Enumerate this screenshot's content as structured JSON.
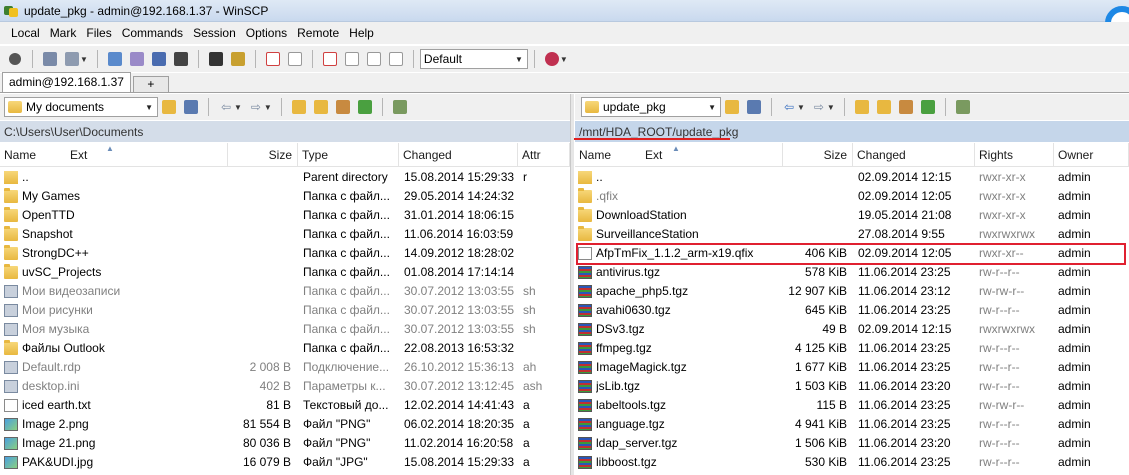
{
  "window": {
    "title": "update_pkg - admin@192.168.1.37 - WinSCP"
  },
  "menu": [
    "Local",
    "Mark",
    "Files",
    "Commands",
    "Session",
    "Options",
    "Remote",
    "Help"
  ],
  "toolbar": {
    "transfer_profile": "Default"
  },
  "tabs": {
    "session": "admin@192.168.1.37",
    "new_tab": "+"
  },
  "local": {
    "location": "My documents",
    "path": "C:\\Users\\User\\Documents",
    "columns": {
      "name": "Name",
      "ext": "Ext",
      "size": "Size",
      "type": "Type",
      "changed": "Changed",
      "attr": "Attr"
    },
    "rows": [
      {
        "name": "..",
        "size": "",
        "type": "Parent directory",
        "changed": "15.08.2014 15:29:33",
        "attr": "r",
        "icon": "up",
        "muted": false
      },
      {
        "name": "My Games",
        "size": "",
        "type": "Папка с файл...",
        "changed": "29.05.2014 14:24:32",
        "attr": "",
        "icon": "folder",
        "muted": false
      },
      {
        "name": "OpenTTD",
        "size": "",
        "type": "Папка с файл...",
        "changed": "31.01.2014 18:06:15",
        "attr": "",
        "icon": "folder",
        "muted": false
      },
      {
        "name": "Snapshot",
        "size": "",
        "type": "Папка с файл...",
        "changed": "11.06.2014 16:03:59",
        "attr": "",
        "icon": "folder",
        "muted": false
      },
      {
        "name": "StrongDC++",
        "size": "",
        "type": "Папка с файл...",
        "changed": "14.09.2012 18:28:02",
        "attr": "",
        "icon": "folder",
        "muted": false
      },
      {
        "name": "uvSC_Projects",
        "size": "",
        "type": "Папка с файл...",
        "changed": "01.08.2014 17:14:14",
        "attr": "",
        "icon": "folder",
        "muted": false
      },
      {
        "name": "Мои видеозаписи",
        "size": "",
        "type": "Папка с файл...",
        "changed": "30.07.2012 13:03:55",
        "attr": "sh",
        "icon": "sysfile",
        "muted": true
      },
      {
        "name": "Мои рисунки",
        "size": "",
        "type": "Папка с файл...",
        "changed": "30.07.2012 13:03:55",
        "attr": "sh",
        "icon": "sysfile",
        "muted": true
      },
      {
        "name": "Моя музыка",
        "size": "",
        "type": "Папка с файл...",
        "changed": "30.07.2012 13:03:55",
        "attr": "sh",
        "icon": "sysfile",
        "muted": true
      },
      {
        "name": "Файлы Outlook",
        "size": "",
        "type": "Папка с файл...",
        "changed": "22.08.2013 16:53:32",
        "attr": "",
        "icon": "folder",
        "muted": false
      },
      {
        "name": "Default.rdp",
        "size": "2 008 B",
        "type": "Подключение...",
        "changed": "26.10.2012 15:36:13",
        "attr": "ah",
        "icon": "sysfile",
        "muted": true
      },
      {
        "name": "desktop.ini",
        "size": "402 B",
        "type": "Параметры к...",
        "changed": "30.07.2012 13:12:45",
        "attr": "ash",
        "icon": "sysfile",
        "muted": true
      },
      {
        "name": "iced earth.txt",
        "size": "81 B",
        "type": "Текстовый до...",
        "changed": "12.02.2014 14:41:43",
        "attr": "a",
        "icon": "doc",
        "muted": false
      },
      {
        "name": "Image 2.png",
        "size": "81 554 B",
        "type": "Файл \"PNG\"",
        "changed": "06.02.2014 18:20:35",
        "attr": "a",
        "icon": "img",
        "muted": false
      },
      {
        "name": "Image 21.png",
        "size": "80 036 B",
        "type": "Файл \"PNG\"",
        "changed": "11.02.2014 16:20:58",
        "attr": "a",
        "icon": "img",
        "muted": false
      },
      {
        "name": "PAK&UDI.jpg",
        "size": "16 079 B",
        "type": "Файл \"JPG\"",
        "changed": "15.08.2014 15:29:33",
        "attr": "a",
        "icon": "img",
        "muted": false
      }
    ]
  },
  "remote": {
    "location": "update_pkg",
    "path": "/mnt/HDA_ROOT/update_pkg",
    "columns": {
      "name": "Name",
      "ext": "Ext",
      "size": "Size",
      "changed": "Changed",
      "rights": "Rights",
      "owner": "Owner"
    },
    "rows": [
      {
        "name": "..",
        "size": "",
        "changed": "02.09.2014 12:15",
        "rights": "rwxr-xr-x",
        "owner": "admin",
        "icon": "up",
        "muted": false
      },
      {
        "name": ".qfix",
        "size": "",
        "changed": "02.09.2014 12:05",
        "rights": "rwxr-xr-x",
        "owner": "admin",
        "icon": "folder",
        "muted": true
      },
      {
        "name": "DownloadStation",
        "size": "",
        "changed": "19.05.2014 21:08",
        "rights": "rwxr-xr-x",
        "owner": "admin",
        "icon": "folder",
        "muted": false
      },
      {
        "name": "SurveillanceStation",
        "size": "",
        "changed": "27.08.2014 9:55",
        "rights": "rwxrwxrwx",
        "owner": "admin",
        "icon": "folder",
        "muted": false
      },
      {
        "name": "AfpTmFix_1.1.2_arm-x19.qfix",
        "size": "406 KiB",
        "changed": "02.09.2014 12:05",
        "rights": "rwxr-xr--",
        "owner": "admin",
        "icon": "doc",
        "muted": false
      },
      {
        "name": "antivirus.tgz",
        "size": "578 KiB",
        "changed": "11.06.2014 23:25",
        "rights": "rw-r--r--",
        "owner": "admin",
        "icon": "arch",
        "muted": false
      },
      {
        "name": "apache_php5.tgz",
        "size": "12 907 KiB",
        "changed": "11.06.2014 23:12",
        "rights": "rw-rw-r--",
        "owner": "admin",
        "icon": "arch",
        "muted": false
      },
      {
        "name": "avahi0630.tgz",
        "size": "645 KiB",
        "changed": "11.06.2014 23:25",
        "rights": "rw-r--r--",
        "owner": "admin",
        "icon": "arch",
        "muted": false
      },
      {
        "name": "DSv3.tgz",
        "size": "49 B",
        "changed": "02.09.2014 12:15",
        "rights": "rwxrwxrwx",
        "owner": "admin",
        "icon": "arch",
        "muted": false
      },
      {
        "name": "ffmpeg.tgz",
        "size": "4 125 KiB",
        "changed": "11.06.2014 23:25",
        "rights": "rw-r--r--",
        "owner": "admin",
        "icon": "arch",
        "muted": false
      },
      {
        "name": "ImageMagick.tgz",
        "size": "1 677 KiB",
        "changed": "11.06.2014 23:25",
        "rights": "rw-r--r--",
        "owner": "admin",
        "icon": "arch",
        "muted": false
      },
      {
        "name": "jsLib.tgz",
        "size": "1 503 KiB",
        "changed": "11.06.2014 23:20",
        "rights": "rw-r--r--",
        "owner": "admin",
        "icon": "arch",
        "muted": false
      },
      {
        "name": "labeltools.tgz",
        "size": "115 B",
        "changed": "11.06.2014 23:25",
        "rights": "rw-rw-r--",
        "owner": "admin",
        "icon": "arch",
        "muted": false
      },
      {
        "name": "language.tgz",
        "size": "4 941 KiB",
        "changed": "11.06.2014 23:25",
        "rights": "rw-r--r--",
        "owner": "admin",
        "icon": "arch",
        "muted": false
      },
      {
        "name": "ldap_server.tgz",
        "size": "1 506 KiB",
        "changed": "11.06.2014 23:20",
        "rights": "rw-r--r--",
        "owner": "admin",
        "icon": "arch",
        "muted": false
      },
      {
        "name": "libboost.tgz",
        "size": "530 KiB",
        "changed": "11.06.2014 23:25",
        "rights": "rw-r--r--",
        "owner": "admin",
        "icon": "arch",
        "muted": false
      }
    ]
  },
  "colors": {
    "highlight_box": "#e02030",
    "path_bar": "#d4dde9",
    "muted_text": "#808080"
  }
}
